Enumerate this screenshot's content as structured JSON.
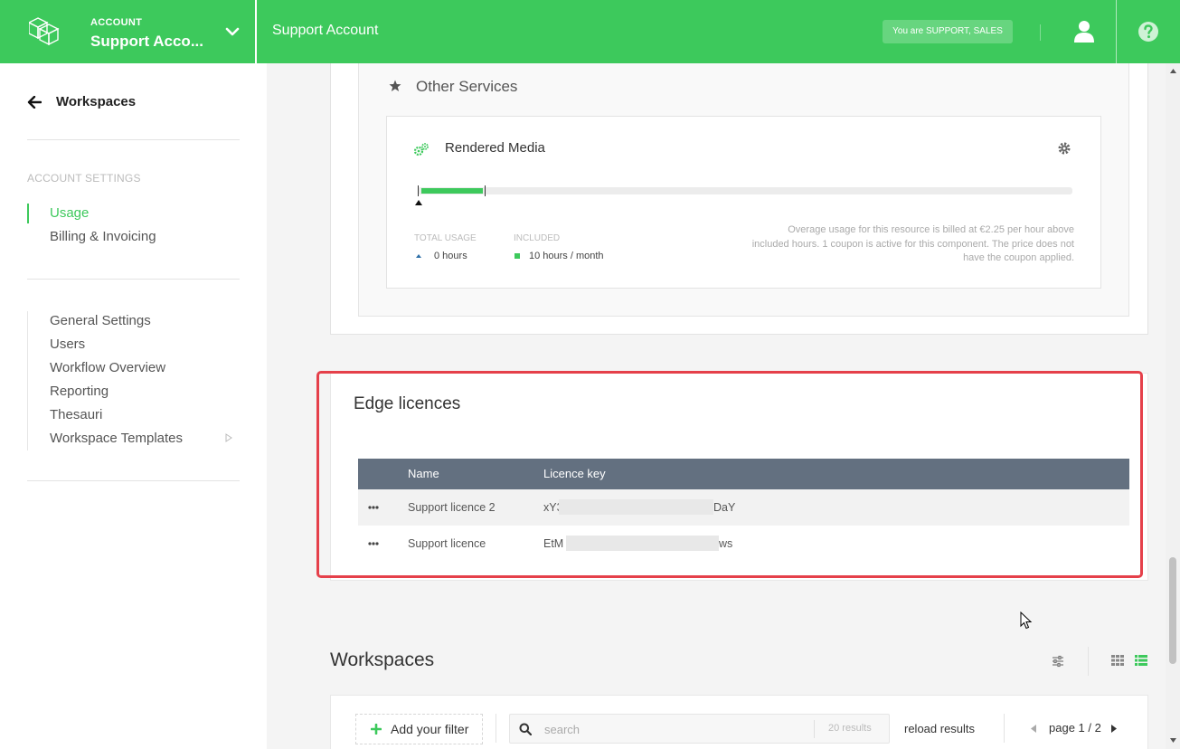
{
  "header": {
    "account_label": "ACCOUNT",
    "account_name": "Support Acco...",
    "page_title": "Support Account",
    "role_badge": "You are SUPPORT, SALES"
  },
  "sidebar": {
    "back_label": "Workspaces",
    "section_title": "ACCOUNT SETTINGS",
    "settings_items": [
      {
        "label": "Usage",
        "active": true
      },
      {
        "label": "Billing & Invoicing",
        "active": false
      }
    ],
    "nav_items": [
      {
        "label": "General Settings"
      },
      {
        "label": "Users"
      },
      {
        "label": "Workflow Overview"
      },
      {
        "label": "Reporting"
      },
      {
        "label": "Thesauri"
      },
      {
        "label": "Workspace Templates"
      }
    ]
  },
  "other_services": {
    "title": "Other Services",
    "card": {
      "title": "Rendered Media",
      "usage_fraction": 0.1,
      "total_usage_label": "TOTAL USAGE",
      "total_usage_value": "0 hours",
      "included_label": "INCLUDED",
      "included_value": "10 hours / month",
      "note": "Overage usage for this resource is billed at €2.25 per hour above included hours. 1 coupon is active for this component. The price does not have the coupon applied."
    }
  },
  "edge_licences": {
    "title": "Edge licences",
    "columns": [
      "Name",
      "Licence key"
    ],
    "rows": [
      {
        "name": "Support licence 2",
        "key_start": "xY3",
        "key_end": "DaY"
      },
      {
        "name": "Support licence",
        "key_start": "EtM",
        "key_end": "ws"
      }
    ]
  },
  "workspaces": {
    "title": "Workspaces",
    "add_filter_label": "Add your filter",
    "search_placeholder": "search",
    "results_count": "20 results",
    "reload_label": "reload results",
    "page_label": "page 1 / 2"
  },
  "colors": {
    "brand_green": "#3dc95c",
    "table_header": "#637080",
    "highlight_red": "#e5404a"
  }
}
